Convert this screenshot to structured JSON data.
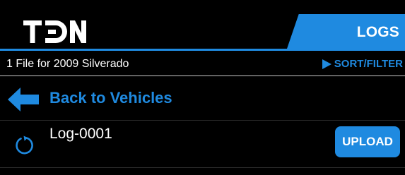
{
  "header": {
    "logo_text": "TDN",
    "screen_title": "LOGS"
  },
  "subbar": {
    "file_count_text": "1 File for 2009 Silverado",
    "sort_filter_label": "SORT/FILTER"
  },
  "back": {
    "label": "Back to Vehicles",
    "icon": "arrow-left-icon"
  },
  "logs": [
    {
      "name": "Log-0001",
      "status_icon": "refresh-icon",
      "action_label": "UPLOAD"
    }
  ],
  "colors": {
    "accent": "#1f8ae0",
    "background": "#000000",
    "text": "#ffffff",
    "divider": "#c8c8c8"
  }
}
